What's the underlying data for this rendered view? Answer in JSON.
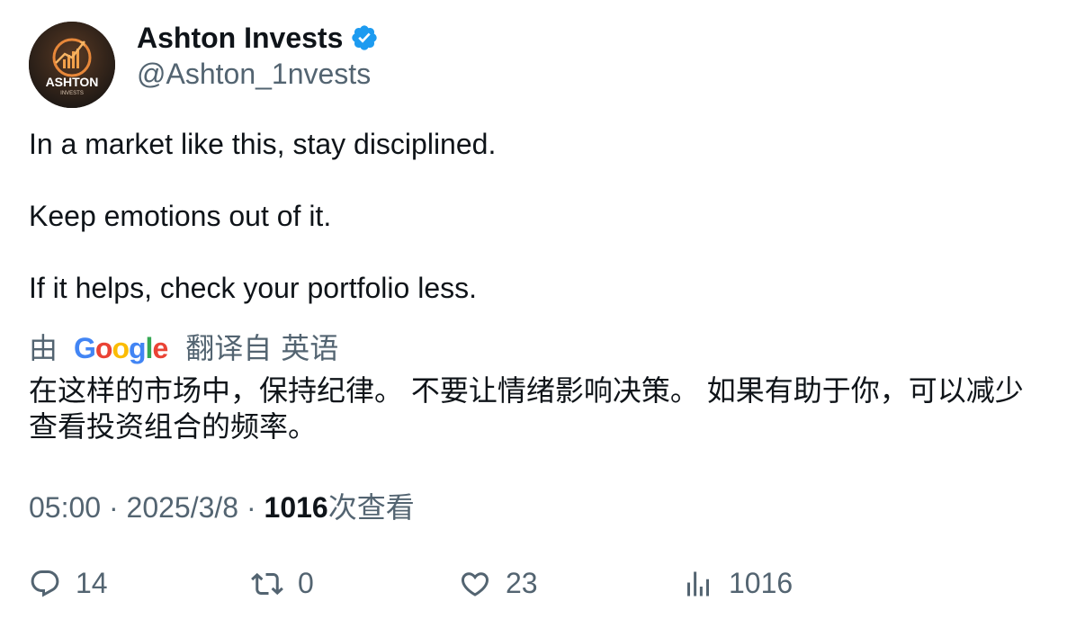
{
  "author": {
    "display_name": "Ashton Invests",
    "handle": "@Ashton_1nvests",
    "avatar_text": "ASHTON",
    "avatar_subtext": "INVESTS",
    "verified": true
  },
  "tweet": {
    "lines": [
      "In a market like this, stay disciplined.",
      "Keep emotions out of it.",
      "If it helps, check your portfolio less."
    ]
  },
  "translation": {
    "by_prefix": "由",
    "provider": "Google",
    "translated_from": "翻译自",
    "source_language": "英语",
    "text": "在这样的市场中，保持纪律。 不要让情绪影响决策。 如果有助于你，可以减少查看投资组合的频率。"
  },
  "meta": {
    "time": "05:00",
    "date": "2025/3/8",
    "separator": "·",
    "views": "1016",
    "views_label": "次查看"
  },
  "actions": {
    "reply_count": "14",
    "retweet_count": "0",
    "like_count": "23",
    "view_count": "1016"
  },
  "colors": {
    "text_primary": "#0f1419",
    "text_secondary": "#536471",
    "verified_blue": "#1d9bf0",
    "avatar_orange": "#e8883a"
  },
  "icons": {
    "verified": "verified-badge-icon",
    "reply": "reply-icon",
    "retweet": "retweet-icon",
    "like": "heart-icon",
    "views": "views-chart-icon"
  }
}
